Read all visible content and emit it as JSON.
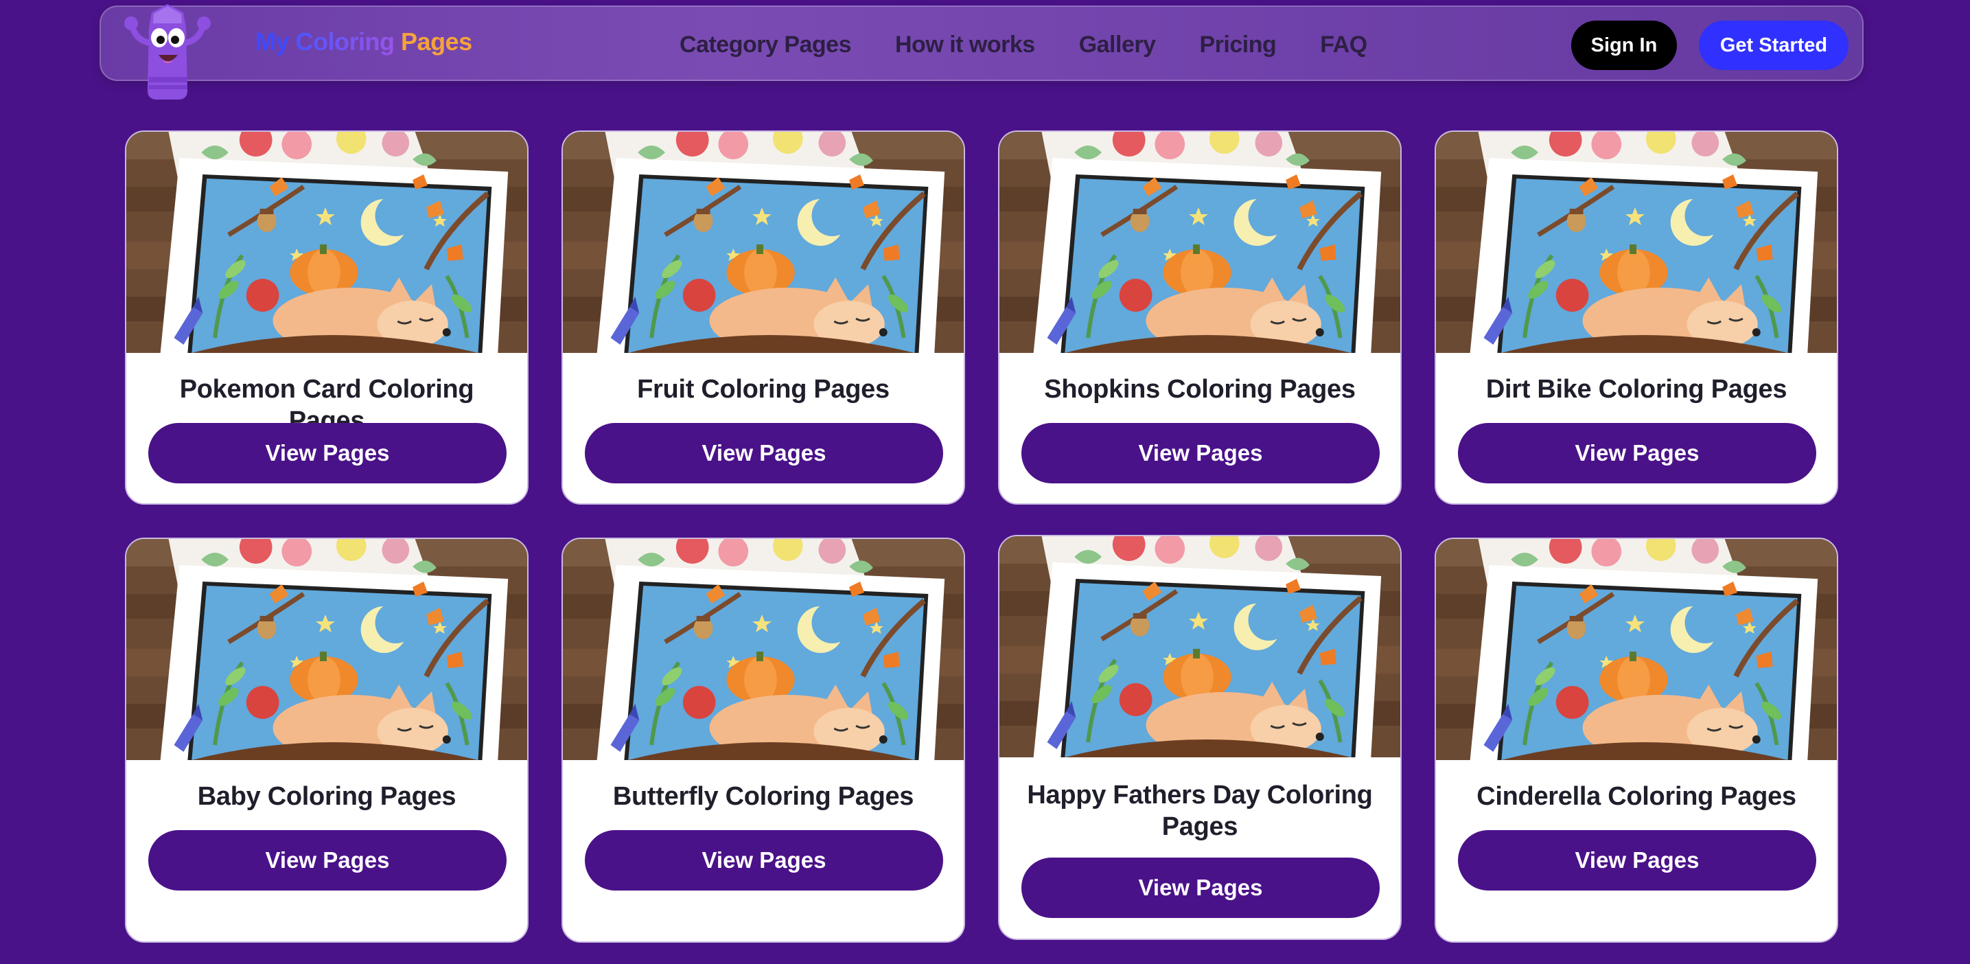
{
  "brand": {
    "part1": "My",
    "part2": "Coloring",
    "part3": "Pages"
  },
  "nav": {
    "items": [
      "Category Pages",
      "How it works",
      "Gallery",
      "Pricing",
      "FAQ"
    ]
  },
  "auth": {
    "sign_in": "Sign In",
    "get_started": "Get Started"
  },
  "cards": [
    {
      "title": "Pokemon Card Coloring Pages",
      "button": "View Pages"
    },
    {
      "title": "Fruit Coloring Pages",
      "button": "View Pages"
    },
    {
      "title": "Shopkins Coloring Pages",
      "button": "View Pages"
    },
    {
      "title": "Dirt Bike Coloring Pages",
      "button": "View Pages"
    },
    {
      "title": "Baby Coloring Pages",
      "button": "View Pages"
    },
    {
      "title": "Butterfly Coloring Pages",
      "button": "View Pages"
    },
    {
      "title": "Happy Fathers Day Coloring Pages",
      "button": "View Pages"
    },
    {
      "title": "Cinderella Coloring Pages",
      "button": "View Pages"
    }
  ],
  "colors": {
    "background": "#4a1289",
    "button_primary": "#4a1289",
    "get_started": "#3030ff",
    "sign_in": "#000000"
  }
}
